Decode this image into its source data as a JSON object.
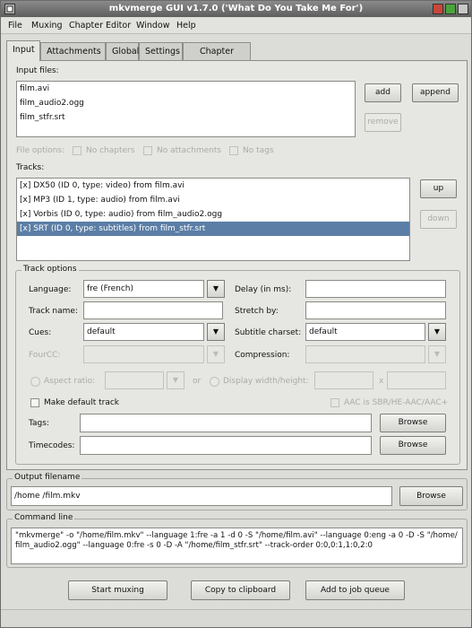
{
  "window": {
    "title": "mkvmerge GUI v1.7.0 ('What Do You Take Me For')"
  },
  "menu": [
    "File",
    "Muxing",
    "Chapter Editor",
    "Window",
    "Help"
  ],
  "tabs": [
    "Input",
    "Attachments",
    "Global",
    "Settings",
    "Chapter Editor"
  ],
  "input_files": {
    "label": "Input files:",
    "items": [
      "film.avi",
      "film_audio2.ogg",
      "film_stfr.srt"
    ],
    "add": "add",
    "append": "append",
    "remove": "remove"
  },
  "file_options": {
    "label": "File options:",
    "no_chapters": "No chapters",
    "no_attachments": "No attachments",
    "no_tags": "No tags"
  },
  "tracks": {
    "label": "Tracks:",
    "items": [
      "[x] DX50 (ID 0, type: video) from film.avi",
      "[x] MP3 (ID 1, type: audio) from film.avi",
      "[x] Vorbis (ID 0, type: audio) from film_audio2.ogg",
      "[x] SRT (ID 0, type: subtitles) from film_stfr.srt"
    ],
    "selected_index": 3,
    "up": "up",
    "down": "down"
  },
  "track_options": {
    "title": "Track options",
    "language_label": "Language:",
    "language_value": "fre (French)",
    "delay_label": "Delay (in ms):",
    "delay_value": "",
    "track_name_label": "Track name:",
    "track_name_value": "",
    "stretch_label": "Stretch by:",
    "stretch_value": "",
    "cues_label": "Cues:",
    "cues_value": "default",
    "charset_label": "Subtitle charset:",
    "charset_value": "default",
    "fourcc_label": "FourCC:",
    "compression_label": "Compression:",
    "aspect_label": "Aspect ratio:",
    "or_label": "or",
    "display_label": "Display width/height:",
    "x_label": "x",
    "default_track_label": "Make default track",
    "aac_label": "AAC is SBR/HE-AAC/AAC+",
    "tags_label": "Tags:",
    "timecodes_label": "Timecodes:",
    "browse": "Browse"
  },
  "output": {
    "title": "Output filename",
    "value": "/home /film.mkv",
    "browse": "Browse"
  },
  "command_line": {
    "title": "Command line",
    "line1": "\"mkvmerge\" -o \"/home/film.mkv\" --language 1:fre -a 1 -d 0 -S \"/home/film.avi\" --language 0:eng -a 0 -D -S \"/home/",
    "line2": "film_audio2.ogg\" --language 0:fre -s 0 -D -A \"/home/film_stfr.srt\" --track-order 0:0,0:1,1:0,2:0"
  },
  "actions": {
    "start": "Start muxing",
    "copy": "Copy to clipboard",
    "queue": "Add to job queue"
  }
}
